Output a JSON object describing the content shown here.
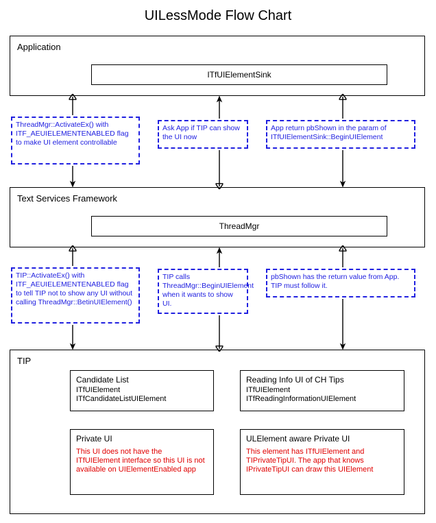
{
  "chart_data": {
    "type": "diagram",
    "title": "UILessMode Flow Chart",
    "nodes": [
      {
        "id": "application",
        "type": "container",
        "label": "Application",
        "children": [
          "itfuielementsink"
        ]
      },
      {
        "id": "itfuielementsink",
        "type": "box",
        "label": "ITfUIElementSink"
      },
      {
        "id": "tsf",
        "type": "container",
        "label": "Text Services Framework",
        "children": [
          "threadmgr"
        ]
      },
      {
        "id": "threadmgr",
        "type": "box",
        "label": "ThreadMgr"
      },
      {
        "id": "tip",
        "type": "container",
        "label": "TIP",
        "children": [
          "candidate",
          "reading",
          "private",
          "ulelement"
        ]
      },
      {
        "id": "candidate",
        "type": "box",
        "label": "Candidate List",
        "sub": [
          "ITfUIElement",
          "ITfCandidateListUIElement"
        ]
      },
      {
        "id": "reading",
        "type": "box",
        "label": "Reading Info UI of CH Tips",
        "sub": [
          "ITfUIElement",
          "ITfReadingInformationUIElement"
        ]
      },
      {
        "id": "private",
        "type": "box",
        "label": "Private UI",
        "note": "This UI does not have the ITfUIElement interface so this UI is not available on UIElementEnabled app"
      },
      {
        "id": "ulelement",
        "type": "box",
        "label": "ULElement aware Private UI",
        "note": "This element has ITfUIElement and TIPrivateTipUI. The app that knows IPrivateTipUI can draw this UIElement"
      }
    ],
    "edges": [
      {
        "from": "application",
        "to": "tsf",
        "label": "ThreadMgr::ActivateEx() with ITF_AEUIELEMENTENABLED flag to make UI element controllable",
        "direction": "down"
      },
      {
        "from": "tsf",
        "to": "application",
        "label": "Ask App if TIP can show the UI now",
        "direction": "up"
      },
      {
        "from": "application",
        "to": "tsf",
        "label": "App return pbShown in the param of ITfUIElementSink::BeginUIElement",
        "direction": "down"
      },
      {
        "from": "tsf",
        "to": "tip",
        "label": "TIP::ActivateEx() with ITF_AEUIELEMENTENABLED flag to tell TIP not to show any UI without calling ThreadMgr::BetinUIElement()",
        "direction": "down"
      },
      {
        "from": "tip",
        "to": "tsf",
        "label": "TIP calls ThreadMgr::BeginUIElement when it wants to show UI.",
        "direction": "up"
      },
      {
        "from": "tsf",
        "to": "tip",
        "label": "pbShown has the return value from App. TIP must follow it.",
        "direction": "down"
      }
    ]
  },
  "title": "UILessMode Flow Chart",
  "app": {
    "label": "Application",
    "inner": "ITfUIElementSink"
  },
  "tsf": {
    "label": "Text Services Framework",
    "inner": "ThreadMgr"
  },
  "tip": {
    "label": "TIP"
  },
  "notes": {
    "n1": "ThreadMgr::ActivateEx() with ITF_AEUIELEMENTENABLED flag to make UI element controllable",
    "n2": "Ask App if TIP can show the UI now",
    "n3": "App return pbShown in the param of ITfUIElementSink::BeginUIElement",
    "n4": "TIP::ActivateEx() with ITF_AEUIELEMENTENABLED flag to tell TIP not to show any UI without calling ThreadMgr::BetinUIElement()",
    "n5": "TIP calls ThreadMgr::BeginUIElement when it wants to show UI.",
    "n6": "pbShown has the return value from App. TIP must follow it."
  },
  "tipboxes": {
    "cand": {
      "title": "Candidate List",
      "l1": "ITfUIElement",
      "l2": "ITfCandidateListUIElement"
    },
    "read": {
      "title": "Reading Info UI of CH Tips",
      "l1": "ITfUIElement",
      "l2": "ITfReadingInformationUIElement"
    },
    "priv": {
      "title": "Private UI",
      "note": "This UI does not have the ITfUIElement interface so this UI is not available on UIElementEnabled app"
    },
    "ule": {
      "title": "ULElement aware Private UI",
      "note": "This element has ITfUIElement and TIPrivateTipUI. The app that knows IPrivateTipUI can draw this UIElement"
    }
  }
}
